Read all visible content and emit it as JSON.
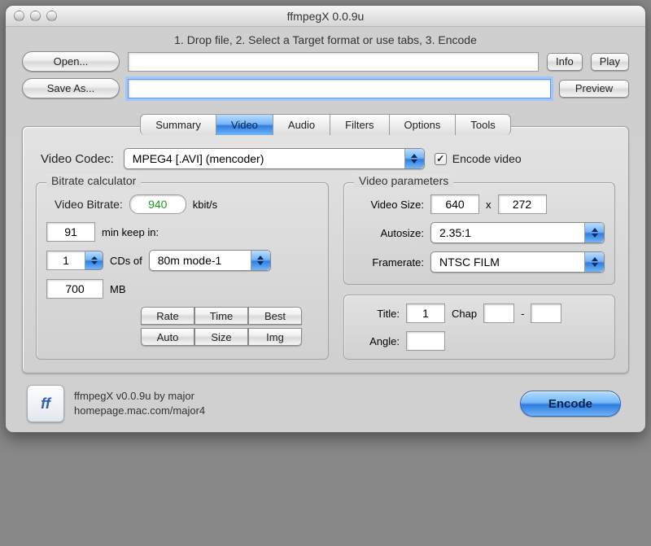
{
  "window": {
    "title": "ffmpegX 0.0.9u"
  },
  "instructions": "1. Drop file, 2. Select a Target format or use tabs, 3. Encode",
  "io": {
    "open_label": "Open...",
    "save_label": "Save As...",
    "info_label": "Info",
    "play_label": "Play",
    "preview_label": "Preview",
    "open_path": "",
    "save_path": ""
  },
  "tabs": {
    "summary": "Summary",
    "video": "Video",
    "audio": "Audio",
    "filters": "Filters",
    "options": "Options",
    "tools": "Tools"
  },
  "codec": {
    "label": "Video Codec:",
    "value": "MPEG4 [.AVI] (mencoder)",
    "encode_label": "Encode video",
    "encode_checked": true
  },
  "bitrate": {
    "group_title": "Bitrate calculator",
    "bitrate_label": "Video Bitrate:",
    "bitrate_value": "940",
    "bitrate_unit": "kbit/s",
    "minutes_value": "91",
    "minutes_label": "min keep in:",
    "cds_count": "1",
    "cds_label": "CDs of",
    "cd_type": "80m mode-1",
    "mb_value": "700",
    "mb_label": "MB",
    "btns": {
      "rate": "Rate",
      "time": "Time",
      "best": "Best",
      "auto": "Auto",
      "size": "Size",
      "img": "Img"
    }
  },
  "params": {
    "group_title": "Video parameters",
    "size_label": "Video Size:",
    "size_w": "640",
    "size_x": "x",
    "size_h": "272",
    "autosize_label": "Autosize:",
    "autosize_value": "2.35:1",
    "framerate_label": "Framerate:",
    "framerate_value": "NTSC FILM",
    "title_label": "Title:",
    "title_value": "1",
    "chap_label": "Chap",
    "chap_from": "",
    "chap_sep": "-",
    "chap_to": "",
    "angle_label": "Angle:",
    "angle_value": ""
  },
  "footer": {
    "icon_text": "ff",
    "line1": "ffmpegX v0.0.9u by major",
    "line2": "homepage.mac.com/major4",
    "encode_label": "Encode"
  }
}
